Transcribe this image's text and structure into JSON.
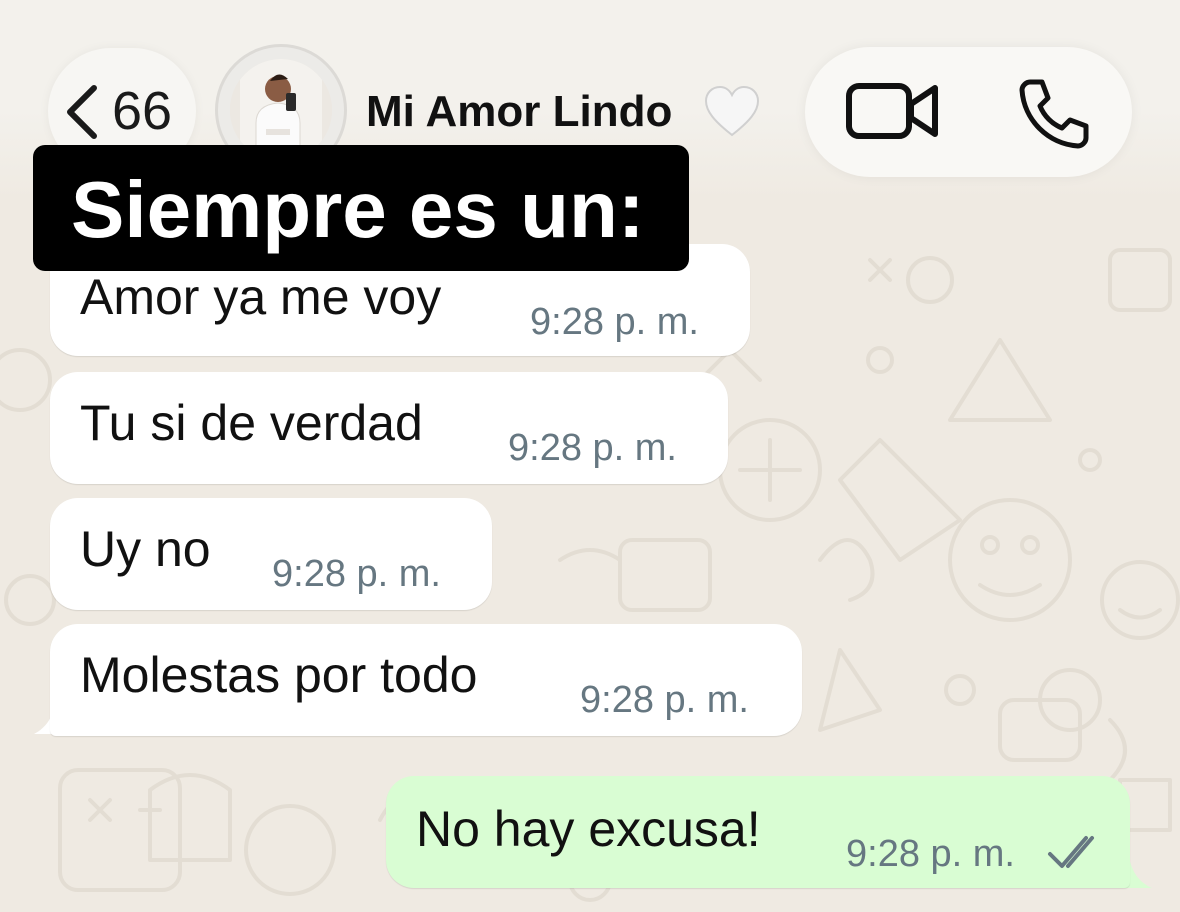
{
  "header": {
    "back_count": "66",
    "contact_name": "Mi Amor Lindo",
    "icons": [
      "chevron-left-icon",
      "avatar",
      "white-heart-icon",
      "video-call-icon",
      "phone-call-icon"
    ]
  },
  "caption": {
    "text": "Siempre es un:"
  },
  "messages": [
    {
      "direction": "incoming",
      "text": "Amor ya me voy",
      "time": "9:28 p. m."
    },
    {
      "direction": "incoming",
      "text": "Tu si de verdad",
      "time": "9:28 p. m."
    },
    {
      "direction": "incoming",
      "text": "Uy no",
      "time": "9:28 p. m."
    },
    {
      "direction": "incoming",
      "text": "Molestas por todo",
      "time": "9:28 p. m."
    },
    {
      "direction": "outgoing",
      "text": "No hay excusa!",
      "time": "9:28 p. m.",
      "status": "read"
    }
  ],
  "colors": {
    "background": "#efeae2",
    "incoming_bubble": "#ffffff",
    "outgoing_bubble": "#d9fdd3",
    "timestamp": "#667781",
    "caption_bg": "#000000",
    "caption_text": "#ffffff"
  }
}
